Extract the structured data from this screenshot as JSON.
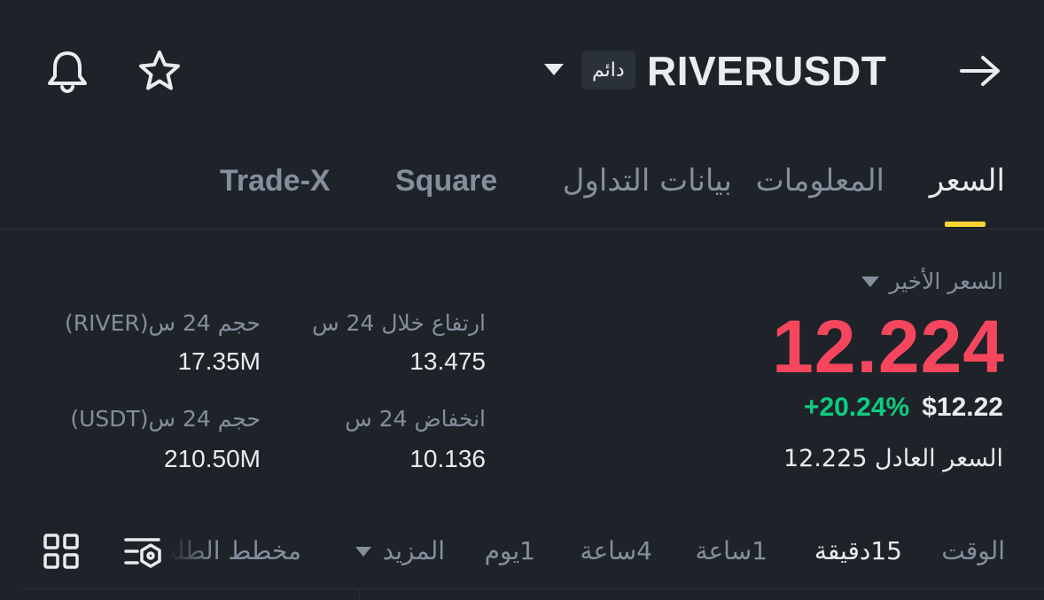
{
  "header": {
    "symbol": "RIVERUSDT",
    "contract_badge": "دائم",
    "icons": {
      "bell": "bell-icon",
      "star": "star-icon",
      "back": "arrow-right-icon",
      "dropdown": "caret-down-icon"
    }
  },
  "tabs": [
    {
      "label": "السعر",
      "active": true
    },
    {
      "label": "المعلومات",
      "active": false
    },
    {
      "label": "بيانات التداول",
      "active": false
    },
    {
      "label": "Square",
      "active": false
    },
    {
      "label": "Trade-X",
      "active": false
    }
  ],
  "price_panel": {
    "last_price_label": "السعر الأخير",
    "last_price": "12.224",
    "usd_price": "$12.22",
    "change_pct": "+20.24%",
    "fair_price_label": "السعر العادل",
    "fair_price": "12.225"
  },
  "stats": {
    "high_label": "ارتفاع خلال 24 س",
    "high_value": "13.475",
    "low_label": "انخفاض 24 س",
    "low_value": "10.136",
    "vol_river_label": "حجم 24 س(RIVER)",
    "vol_river_value": "17.35M",
    "vol_usdt_label": "حجم 24 س(USDT)",
    "vol_usdt_value": "210.50M"
  },
  "intervals": {
    "time_label": "الوقت",
    "items": [
      "15دقيقة",
      "1ساعة",
      "4ساعة",
      "1يوم"
    ],
    "active": "15دقيقة",
    "more_label": "المزيد",
    "depth_label": "مخطط الطلب"
  },
  "colors": {
    "background": "#1e2329",
    "accent_yellow": "#fcd535",
    "down_red": "#f6465d",
    "up_green": "#0ecb81",
    "text_primary": "#eaecef",
    "text_secondary": "#848e9c"
  }
}
